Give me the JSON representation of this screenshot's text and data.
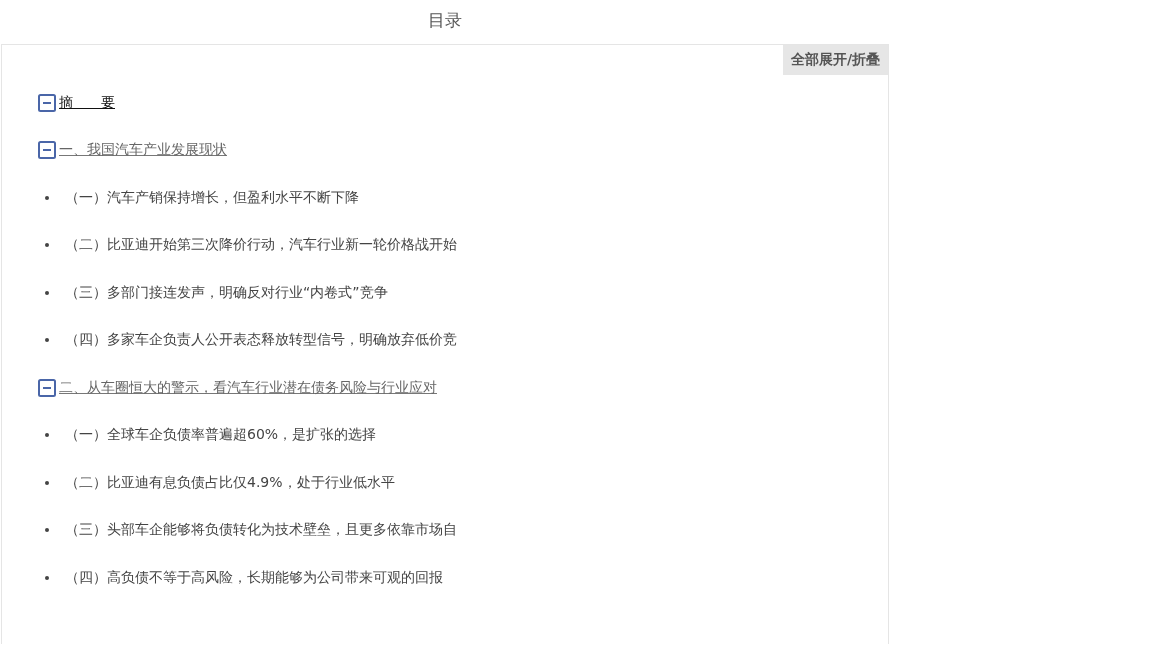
{
  "title": "目录",
  "toggle_all_button": "全部展开/折叠",
  "sections": [
    {
      "label": "摘　　要",
      "selected": true,
      "expanded": true
    },
    {
      "label": "一、我国汽车产业发展现状",
      "selected": false,
      "expanded": true,
      "children": [
        {
          "label": "（一）汽车产销保持增长，但盈利水平不断下降"
        },
        {
          "label": "（二）比亚迪开始第三次降价行动，汽车行业新一轮价格战开始"
        },
        {
          "label": "（三）多部门接连发声，明确反对行业“内卷式”竞争"
        },
        {
          "label": "（四）多家车企负责人公开表态释放转型信号，明确放弃低价竞"
        }
      ]
    },
    {
      "label": "二、从车圈恒大的警示，看汽车行业潜在债务风险与行业应对",
      "selected": false,
      "expanded": true,
      "children": [
        {
          "label": "（一）全球车企负债率普遍超60%，是扩张的选择"
        },
        {
          "label": "（二）比亚迪有息负债占比仅4.9%，处于行业低水平"
        },
        {
          "label": "（三）头部车企能够将负债转化为技术壁垒，且更多依靠市场自"
        },
        {
          "label": "（四）高负债不等于高风险，长期能够为公司带来可观的回报"
        }
      ]
    }
  ]
}
